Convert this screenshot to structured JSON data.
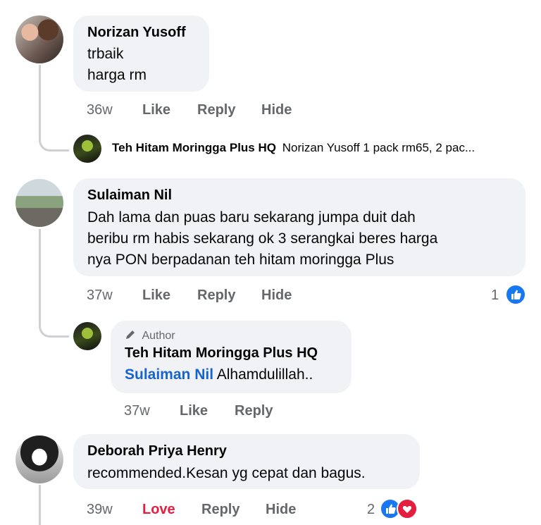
{
  "comments": [
    {
      "author": "Norizan Yusoff",
      "lines": [
        "trbaik",
        "harga rm"
      ],
      "time": "36w",
      "like": "Like",
      "reply": "Reply",
      "hide": "Hide",
      "reply_preview": {
        "author": "Teh Hitam Moringga Plus HQ",
        "text": "Norizan Yusoff 1 pack rm65, 2 pac..."
      }
    },
    {
      "author": "Sulaiman Nil",
      "lines": [
        "Dah lama dan puas baru sekarang jumpa duit dah",
        "beribu rm habis sekarang ok 3 serangkai beres harga",
        "nya PON berpadanan teh hitam moringga Plus"
      ],
      "time": "37w",
      "like": "Like",
      "reply": "Reply",
      "hide": "Hide",
      "reaction_count": "1",
      "reply_full": {
        "badge": "Author",
        "author": "Teh Hitam Moringga Plus HQ",
        "mention": "Sulaiman Nil",
        "text": "Alhamdulillah..",
        "time": "37w",
        "like": "Like",
        "reply": "Reply"
      }
    },
    {
      "author": "Deborah Priya Henry",
      "lines": [
        "recommended.Kesan yg cepat dan bagus."
      ],
      "time": "39w",
      "love": "Love",
      "reply": "Reply",
      "hide": "Hide",
      "reaction_count": "2"
    }
  ],
  "colors": {
    "love": "#e41e3f",
    "link": "#1763cf",
    "like_blue": "#1877f2",
    "bubble": "#f0f2f5"
  },
  "icons": [
    "like-reaction-icon",
    "love-reaction-icon",
    "pencil-icon"
  ]
}
